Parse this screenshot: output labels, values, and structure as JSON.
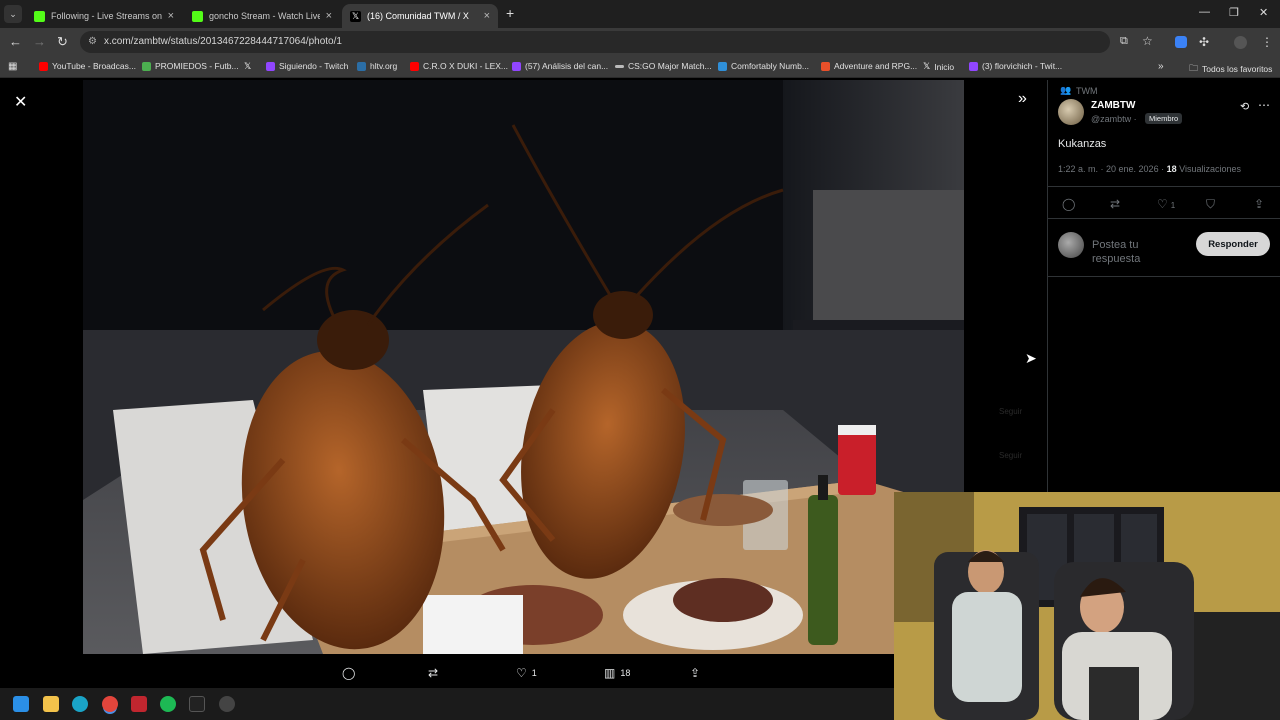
{
  "browser": {
    "tabs": [
      {
        "label": "Following - Live Streams on Kick",
        "active": false,
        "color": "#53fc18"
      },
      {
        "label": "goncho Stream - Watch Live on Kick",
        "active": false,
        "color": "#53fc18"
      },
      {
        "label": "(16) Comunidad TWM / X",
        "active": true,
        "color": "#ffffff"
      }
    ],
    "new_tab": "+",
    "url": "x.com/zambtw/status/2013467228444717064/photo/1",
    "bookmarks": [
      {
        "label": "YouTube - Broadcas...",
        "color": "#ff0000"
      },
      {
        "label": "PROMIEDOS - Futb...",
        "color": "#4caf50"
      },
      {
        "label": "",
        "color": "#ffffff"
      },
      {
        "label": "Siguiendo - Twitch",
        "color": "#9146ff"
      },
      {
        "label": "hltv.org",
        "color": "#2b6ea6"
      },
      {
        "label": "C.R.O X DUKI - LEX...",
        "color": "#ff0000"
      },
      {
        "label": "(57) Análisis del can...",
        "color": "#9146ff"
      },
      {
        "label": "CS:GO Major Match...",
        "color": "#bbbbbb"
      },
      {
        "label": "Comfortably Numb...",
        "color": "#2f8fd8"
      },
      {
        "label": "Adventure and RPG...",
        "color": "#e8502a"
      },
      {
        "label": "Inicio",
        "color": "#ffffff"
      },
      {
        "label": "(3) florvichich - Twit...",
        "color": "#9146ff"
      }
    ],
    "all_bookmarks": "Todos los favoritos"
  },
  "viewer": {
    "actions": {
      "likes": "1",
      "views": "18"
    }
  },
  "post": {
    "community": "TWM",
    "display_name": "ZAMBTW",
    "handle": "@zambtw ·",
    "badge": "Miembro",
    "text": "Kukanzas",
    "time": "1:22 a. m. · 20 ene. 2026 ·",
    "views_count": "18",
    "views_label": "Visualizaciones",
    "likes": "1",
    "reply_placeholder": "Postea tu respuesta",
    "reply_button": "Responder",
    "ghost_follow": "Seguir",
    "ghost_other": "Seguir"
  },
  "colors": {
    "kick_green": "#53fc18",
    "x_bg": "#000000",
    "muted": "#71767b"
  }
}
